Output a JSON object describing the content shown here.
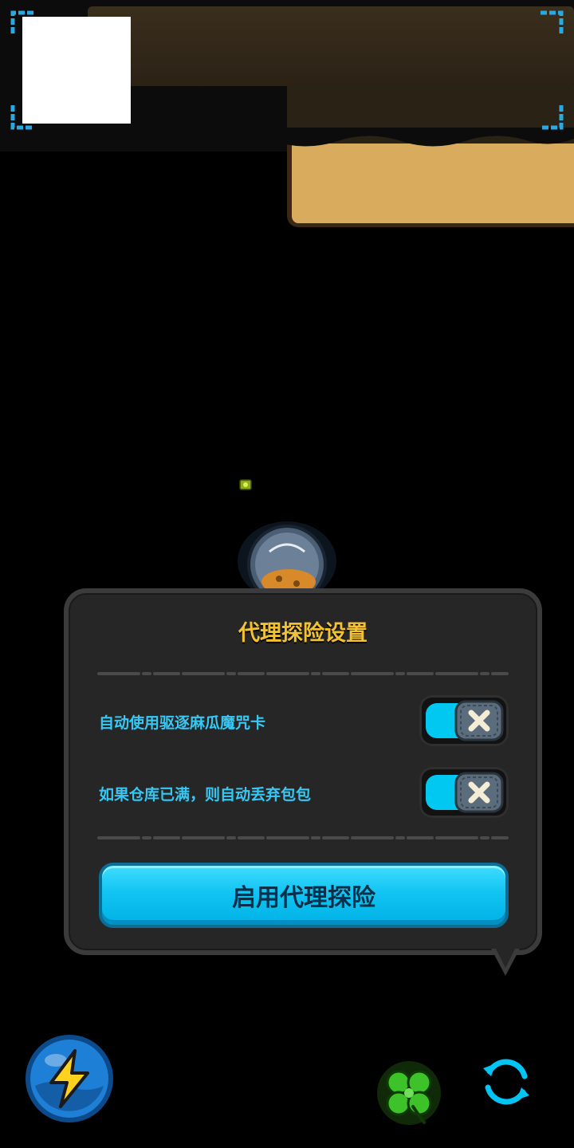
{
  "panel": {
    "title": "代理探险设置",
    "options": [
      {
        "label": "自动使用驱逐麻瓜魔咒卡",
        "enabled": true
      },
      {
        "label": "如果仓库已满，则自动丢弃包包",
        "enabled": true
      }
    ],
    "start_button_label": "启用代理探险"
  },
  "icons": {
    "energy": "lightning-bolt-icon",
    "luck": "four-leaf-clover-icon",
    "refresh": "refresh-arrows-icon",
    "toggle_knob": "x-mark-icon"
  },
  "colors": {
    "accent": "#00c8f0",
    "title": "#f2c232",
    "label": "#36c8f5",
    "panel_bg": "#262626"
  }
}
